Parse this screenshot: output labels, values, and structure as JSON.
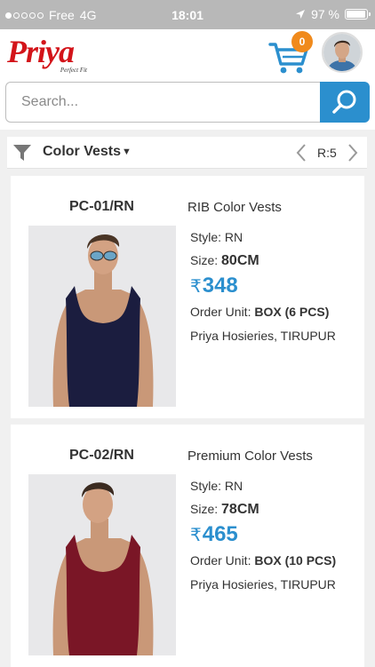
{
  "status": {
    "carrier": "Free",
    "network": "4G",
    "time": "18:01",
    "battery": "97 %",
    "battery_level": 0.97
  },
  "header": {
    "logo_text": "Priya",
    "logo_tagline": "Perfect Fit",
    "cart_count": "0",
    "brand_color": "#d3141a",
    "accent_color": "#2b8fce",
    "badge_color": "#f08a1c"
  },
  "search": {
    "placeholder": "Search...",
    "value": ""
  },
  "filter": {
    "category": "Color Vests",
    "pager": "R:5"
  },
  "products": [
    {
      "code": "PC-01/RN",
      "name": "RIB Color Vests",
      "style_label": "Style:",
      "style": "RN",
      "size_label": "Size:",
      "size": "80CM",
      "currency": "₹",
      "price": "348",
      "unit_label": "Order Unit:",
      "unit": "BOX (6 PCS)",
      "seller": "Priya Hosieries, TIRUPUR",
      "vest_color": "#1b1d3f"
    },
    {
      "code": "PC-02/RN",
      "name": "Premium Color Vests",
      "style_label": "Style:",
      "style": "RN",
      "size_label": "Size:",
      "size": "78CM",
      "currency": "₹",
      "price": "465",
      "unit_label": "Order Unit:",
      "unit": "BOX (10 PCS)",
      "seller": "Priya Hosieries, TIRUPUR",
      "vest_color": "#7a1626"
    }
  ]
}
